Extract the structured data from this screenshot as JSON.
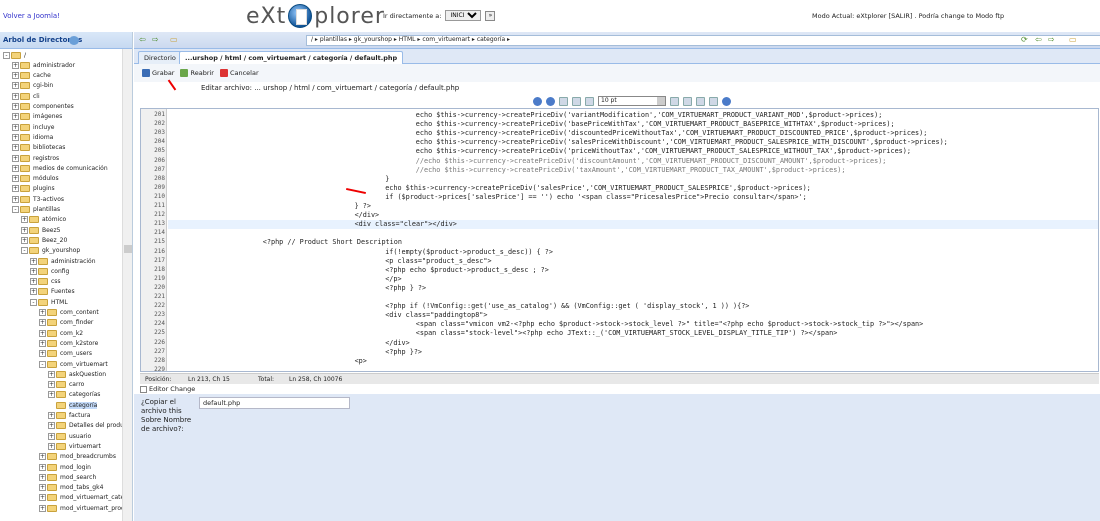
{
  "header": {
    "back_link": "Volver a Joomla!",
    "logo_left": "eXt",
    "logo_right": "plorer",
    "goto_label": "Ir directamente a:",
    "goto_value": "INICIO",
    "mode_text": "Modo Actual: eXtplorer [SALIR] . Podría change to Modo ftp"
  },
  "left_panel": {
    "title": "Arbol de Directorios",
    "tree": [
      {
        "label": "/",
        "depth": 0,
        "toggle": "-"
      },
      {
        "label": "administrador",
        "depth": 1,
        "toggle": "+"
      },
      {
        "label": "cache",
        "depth": 1,
        "toggle": "+"
      },
      {
        "label": "cgi-bin",
        "depth": 1,
        "toggle": "+"
      },
      {
        "label": "cli",
        "depth": 1,
        "toggle": "+"
      },
      {
        "label": "componentes",
        "depth": 1,
        "toggle": "+"
      },
      {
        "label": "imágenes",
        "depth": 1,
        "toggle": "+"
      },
      {
        "label": "incluye",
        "depth": 1,
        "toggle": "+"
      },
      {
        "label": "idioma",
        "depth": 1,
        "toggle": "+"
      },
      {
        "label": "bibliotecas",
        "depth": 1,
        "toggle": "+"
      },
      {
        "label": "registros",
        "depth": 1,
        "toggle": "+"
      },
      {
        "label": "medios de comunicación",
        "depth": 1,
        "toggle": "+"
      },
      {
        "label": "módulos",
        "depth": 1,
        "toggle": "+"
      },
      {
        "label": "plugins",
        "depth": 1,
        "toggle": "+"
      },
      {
        "label": "T3-activos",
        "depth": 1,
        "toggle": "+"
      },
      {
        "label": "plantillas",
        "depth": 1,
        "toggle": "-"
      },
      {
        "label": "atómico",
        "depth": 2,
        "toggle": "+"
      },
      {
        "label": "Beez5",
        "depth": 2,
        "toggle": "+"
      },
      {
        "label": "Beez_20",
        "depth": 2,
        "toggle": "+"
      },
      {
        "label": "gk_yourshop",
        "depth": 2,
        "toggle": "-"
      },
      {
        "label": "administración",
        "depth": 3,
        "toggle": "+"
      },
      {
        "label": "config",
        "depth": 3,
        "toggle": "+"
      },
      {
        "label": "css",
        "depth": 3,
        "toggle": "+"
      },
      {
        "label": "Fuentes",
        "depth": 3,
        "toggle": "+"
      },
      {
        "label": "HTML",
        "depth": 3,
        "toggle": "-"
      },
      {
        "label": "com_content",
        "depth": 4,
        "toggle": "+"
      },
      {
        "label": "com_finder",
        "depth": 4,
        "toggle": "+"
      },
      {
        "label": "com_k2",
        "depth": 4,
        "toggle": "+"
      },
      {
        "label": "com_k2store",
        "depth": 4,
        "toggle": "+"
      },
      {
        "label": "com_users",
        "depth": 4,
        "toggle": "+"
      },
      {
        "label": "com_virtuemart",
        "depth": 4,
        "toggle": "-"
      },
      {
        "label": "askQuestion",
        "depth": 5,
        "toggle": "+"
      },
      {
        "label": "carro",
        "depth": 5,
        "toggle": "+"
      },
      {
        "label": "categorías",
        "depth": 5,
        "toggle": "+"
      },
      {
        "label": "categoría",
        "depth": 5,
        "toggle": "",
        "selected": true
      },
      {
        "label": "factura",
        "depth": 5,
        "toggle": "+"
      },
      {
        "label": "Detalles del producto",
        "depth": 5,
        "toggle": "+"
      },
      {
        "label": "usuario",
        "depth": 5,
        "toggle": "+"
      },
      {
        "label": "virtuemart",
        "depth": 5,
        "toggle": "+"
      },
      {
        "label": "mod_breadcrumbs",
        "depth": 4,
        "toggle": "+"
      },
      {
        "label": "mod_login",
        "depth": 4,
        "toggle": "+"
      },
      {
        "label": "mod_search",
        "depth": 4,
        "toggle": "+"
      },
      {
        "label": "mod_tabs_gk4",
        "depth": 4,
        "toggle": "+"
      },
      {
        "label": "mod_virtuemart_category",
        "depth": 4,
        "toggle": "+"
      },
      {
        "label": "mod_virtuemart_product",
        "depth": 4,
        "toggle": "+"
      }
    ]
  },
  "toolbar": {
    "path": "/ ▸ plantillas ▸ gk_yourshop ▸ HTML ▸ com_virtuemart ▸ categoría ▸"
  },
  "tabs": [
    {
      "label": "Directorio",
      "active": false
    },
    {
      "label": "...urshop / html / com_virtuemart / categoría / default.php",
      "active": true
    }
  ],
  "edit_toolbar": {
    "save": "Grabar",
    "reopen": "Reabrir",
    "cancel": "Cancelar",
    "edit_label": "Editar archivo: ... urshop / html / com_virtuemart / categoría / default.php",
    "font_size": "10 pt"
  },
  "code": [
    {
      "n": "201",
      "indent": 48,
      "text": "echo $this->currency->createPriceDiv('variantModification','COM_VIRTUEMART_PRODUCT_VARIANT_MOD',$product->prices);"
    },
    {
      "n": "202",
      "indent": 48,
      "text": "echo $this->currency->createPriceDiv('basePriceWithTax','COM_VIRTUEMART_PRODUCT_BASEPRICE_WITHTAX',$product->prices);"
    },
    {
      "n": "203",
      "indent": 48,
      "text": "echo $this->currency->createPriceDiv('discountedPriceWithoutTax','COM_VIRTUEMART_PRODUCT_DISCOUNTED_PRICE',$product->prices);"
    },
    {
      "n": "204",
      "indent": 48,
      "text": "echo $this->currency->createPriceDiv('salesPriceWithDiscount','COM_VIRTUEMART_PRODUCT_SALESPRICE_WITH_DISCOUNT',$product->prices);"
    },
    {
      "n": "205",
      "indent": 48,
      "text": "echo $this->currency->createPriceDiv('priceWithoutTax','COM_VIRTUEMART_PRODUCT_SALESPRICE_WITHOUT_TAX',$product->prices);"
    },
    {
      "n": "206",
      "indent": 48,
      "text": "//echo $this->currency->createPriceDiv('discountAmount','COM_VIRTUEMART_PRODUCT_DISCOUNT_AMOUNT',$product->prices);",
      "comment": true
    },
    {
      "n": "207",
      "indent": 48,
      "text": "//echo $this->currency->createPriceDiv('taxAmount','COM_VIRTUEMART_PRODUCT_TAX_AMOUNT',$product->prices);",
      "comment": true
    },
    {
      "n": "208",
      "indent": 42,
      "text": "}"
    },
    {
      "n": "209",
      "indent": 42,
      "text": "echo $this->currency->createPriceDiv('salesPrice','COM_VIRTUEMART_PRODUCT_SALESPRICE',$product->prices);"
    },
    {
      "n": "210",
      "indent": 42,
      "text": "if ($product->prices['salesPrice'] == '') echo '<span class=\"PricesalesPrice\">Precio consultar</span>';"
    },
    {
      "n": "211",
      "indent": 36,
      "text": "} ?>"
    },
    {
      "n": "212",
      "indent": 36,
      "text": "</div>"
    },
    {
      "n": "213",
      "indent": 36,
      "text": "<div class=\"clear\"></div>",
      "current": true
    },
    {
      "n": "214",
      "indent": 0,
      "text": ""
    },
    {
      "n": "215",
      "indent": 18,
      "text": "<?php // Product Short Description"
    },
    {
      "n": "216",
      "indent": 42,
      "text": "if(!empty($product->product_s_desc)) { ?>"
    },
    {
      "n": "217",
      "indent": 42,
      "text": "<p class=\"product_s_desc\">"
    },
    {
      "n": "218",
      "indent": 42,
      "text": "<?php echo $product->product_s_desc ; ?>"
    },
    {
      "n": "219",
      "indent": 42,
      "text": "</p>"
    },
    {
      "n": "220",
      "indent": 42,
      "text": "<?php } ?>"
    },
    {
      "n": "221",
      "indent": 0,
      "text": ""
    },
    {
      "n": "222",
      "indent": 42,
      "text": "<?php if (!VmConfig::get('use_as_catalog') && (VmConfig::get ( 'display_stock', 1 )) ){?>"
    },
    {
      "n": "223",
      "indent": 42,
      "text": "<div class=\"paddingtop8\">"
    },
    {
      "n": "224",
      "indent": 48,
      "text": "<span class=\"vmicon vm2-<?php echo $product->stock->stock_level ?>\" title=\"<?php echo $product->stock->stock_tip ?>\"></span>"
    },
    {
      "n": "225",
      "indent": 48,
      "text": "<span class=\"stock-level\"><?php echo JText::_('COM_VIRTUEMART_STOCK_LEVEL_DISPLAY_TITLE_TIP') ?></span>"
    },
    {
      "n": "226",
      "indent": 42,
      "text": "</div>"
    },
    {
      "n": "227",
      "indent": 42,
      "text": "<?php }?>"
    },
    {
      "n": "228",
      "indent": 36,
      "text": "<p>"
    },
    {
      "n": "229",
      "indent": 0,
      "text": ""
    }
  ],
  "status": {
    "pos_label": "Posición:",
    "pos_value": "Ln 213, Ch 15",
    "total_label": "Total:",
    "total_value": "Ln 258, Ch 10076"
  },
  "form": {
    "editor_change": "Editor Change",
    "copy_label": "¿Copiar el archivo this Sobre Nombre de archivo?:",
    "filename": "default.php"
  }
}
